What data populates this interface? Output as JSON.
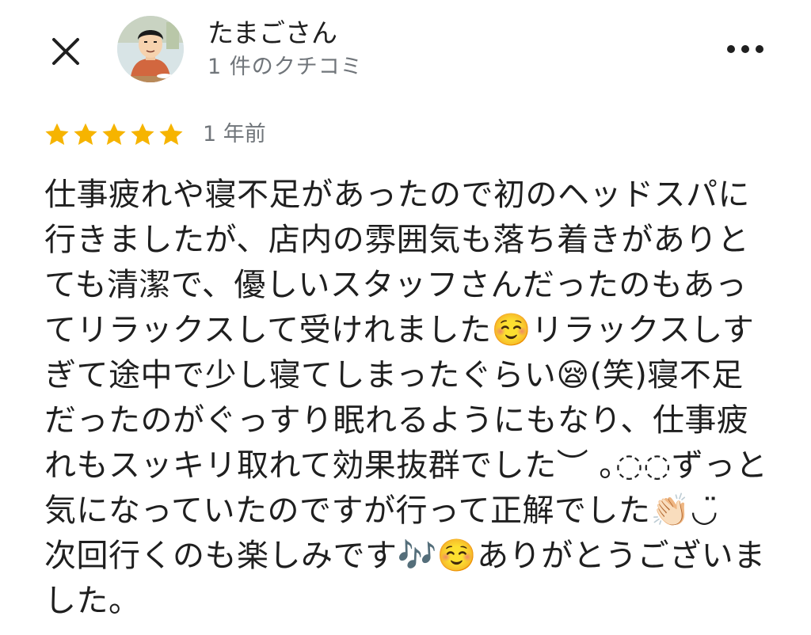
{
  "header": {
    "close_icon": "close-icon",
    "reviewer_name": "たまごさん",
    "review_count": "1 件のクチコミ",
    "more_icon": "more-horizontal-icon"
  },
  "review": {
    "rating": 5,
    "max_rating": 5,
    "star_color": "#f6b400",
    "date": "1 年前",
    "text": "仕事疲れや寝不足があったので初のヘッドスパに行きましたが、店内の雰囲気も落ち着きがありとても清潔で、優しいスタッフさんだったのもあってリラックスして受けれました☺️リラックスしすぎて途中で少し寝てしまったぐらい😪(笑)寝不足だったのがぐっすり眠れるようにもなり、仕事疲れもスッキリ取れて効果抜群でした︶ ｡◌◌ずっと気になっていたのですが行って正解でした👏🏻◡̈\n次回行くのも楽しみです🎶☺️ありがとうございました。"
  },
  "colors": {
    "text_primary": "#1f1f1f",
    "text_secondary": "#70757a",
    "background": "#ffffff"
  }
}
